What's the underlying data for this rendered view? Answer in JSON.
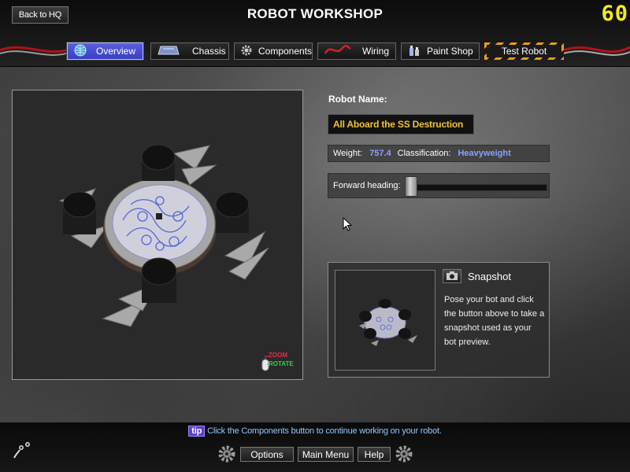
{
  "header": {
    "back_label": "Back to HQ",
    "title": "ROBOT WORKSHOP",
    "counter": "60"
  },
  "tabs": [
    {
      "label": "Overview",
      "icon": "globe-icon",
      "active": true
    },
    {
      "label": "Chassis",
      "icon": "chassis-icon",
      "active": false
    },
    {
      "label": "Components",
      "icon": "gear-icon",
      "active": false
    },
    {
      "label": "Wiring",
      "icon": "wire-icon",
      "active": false
    },
    {
      "label": "Paint Shop",
      "icon": "paint-can-icon",
      "active": false
    },
    {
      "label": "Test Robot",
      "icon": "",
      "active": false
    }
  ],
  "viewport": {
    "zoom_label": "ZOOM",
    "rotate_label": "ROTATE"
  },
  "robot": {
    "name_label": "Robot Name:",
    "name_value": "All Aboard the SS Destruction",
    "weight_label": "Weight:",
    "weight_value": "757.4",
    "class_label": "Classification:",
    "class_value": "Heavyweight",
    "heading_label": "Forward heading:",
    "heading_level": 0.0
  },
  "snapshot": {
    "title": "Snapshot",
    "description": "Pose your bot and click the button above to take a snapshot used as your bot preview."
  },
  "footer": {
    "tip_badge": "tip",
    "tip_text": "Click the Components button to continue working on your robot.",
    "options_label": "Options",
    "main_menu_label": "Main Menu",
    "help_label": "Help"
  },
  "colors": {
    "accent_active_tab": "#4a4fd6",
    "counter": "#f4ea1c",
    "name_text": "#f1c232",
    "stat_value": "#8aa0ff",
    "tip_text": "#8cc8ff",
    "hazard_stripe": "#e8a012"
  }
}
